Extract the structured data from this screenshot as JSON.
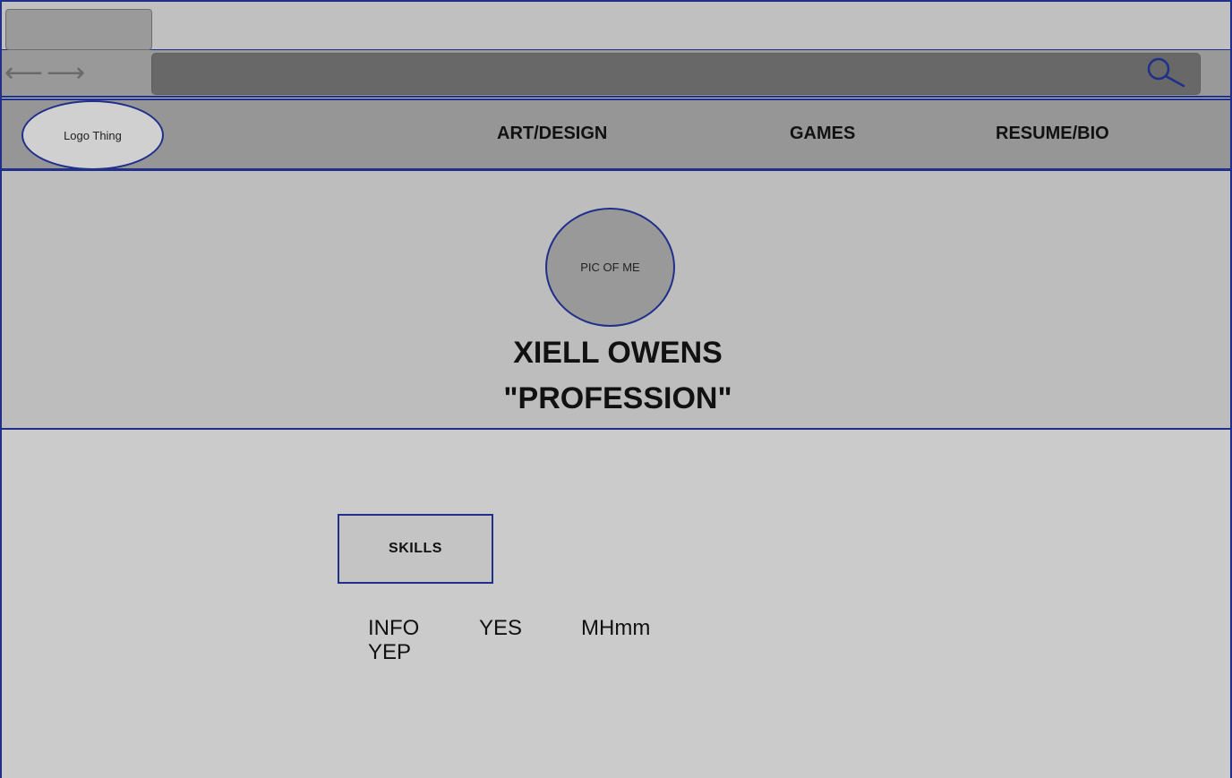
{
  "browser": {
    "url": "",
    "back_glyph": "⟵",
    "forward_glyph": "⟶"
  },
  "header": {
    "logo_label": "Logo Thing",
    "nav": {
      "art": "ART/DESIGN",
      "games": "GAMES",
      "resume": "RESUME/BIO"
    }
  },
  "hero": {
    "photo_label": "PIC OF ME",
    "name": "XIELL OWENS",
    "profession": "\"PROFESSION\""
  },
  "skills": {
    "title": "SKILLS",
    "items": [
      "INFO YEP",
      "YES",
      "MHmm"
    ]
  },
  "colors": {
    "border": "#1f2f8a",
    "header_bg": "#969696",
    "hero_bg": "#bdbdbd",
    "page_bg": "#cbcbcb"
  }
}
